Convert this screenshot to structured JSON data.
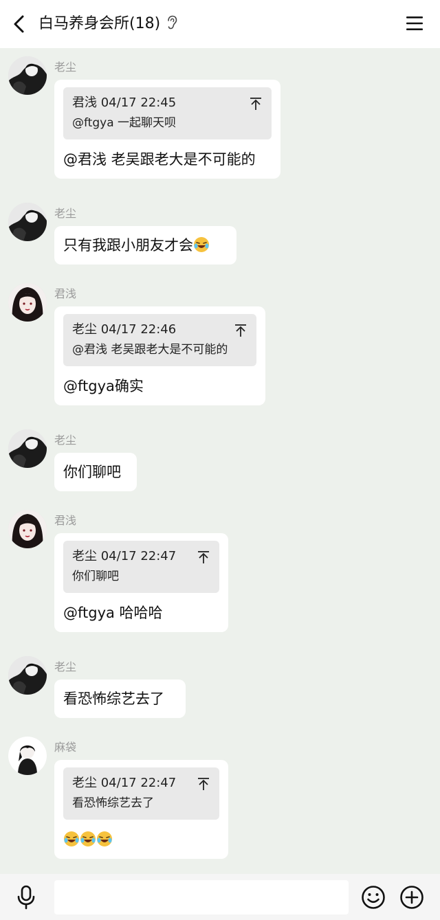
{
  "header": {
    "title": "白马养身会所(18)",
    "back_icon": "chevron-left-icon",
    "ear_icon": "ear-icon",
    "menu_icon": "hamburger-menu-icon"
  },
  "messages": [
    {
      "sender": "老尘",
      "avatar": "avatar-laochen",
      "quote": {
        "head": "君浅 04/17 22:45",
        "body": "@ftgya 一起聊天呗"
      },
      "text": "@君浅 老吴跟老大是不可能的"
    },
    {
      "sender": "老尘",
      "avatar": "avatar-laochen",
      "text": "只有我跟小朋友才会",
      "emoji_count": 1
    },
    {
      "sender": "君浅",
      "avatar": "avatar-junqian",
      "quote": {
        "head": "老尘 04/17 22:46",
        "body": "@君浅 老吴跟老大是不可能的"
      },
      "text": "@ftgya确实"
    },
    {
      "sender": "老尘",
      "avatar": "avatar-laochen",
      "text": "你们聊吧"
    },
    {
      "sender": "君浅",
      "avatar": "avatar-junqian",
      "quote": {
        "head": "老尘 04/17 22:47",
        "body": "你们聊吧"
      },
      "text": "@ftgya 哈哈哈"
    },
    {
      "sender": "老尘",
      "avatar": "avatar-laochen",
      "text": "看恐怖综艺去了"
    },
    {
      "sender": "麻袋",
      "avatar": "avatar-madai",
      "quote": {
        "head": "老尘 04/17 22:47",
        "body": "看恐怖综艺去了"
      },
      "text": "",
      "emoji_count": 3
    }
  ],
  "input_bar": {
    "mic_icon": "microphone-icon",
    "emoji_icon": "smiley-icon",
    "add_icon": "plus-circle-icon",
    "placeholder": ""
  },
  "colors": {
    "chat_background": "#EDF1EC",
    "bubble": "#FFFFFF",
    "quote_background": "#E9E9E9",
    "sender_name": "#9A9A9A",
    "emoji_yellow": "#F6C23E"
  }
}
